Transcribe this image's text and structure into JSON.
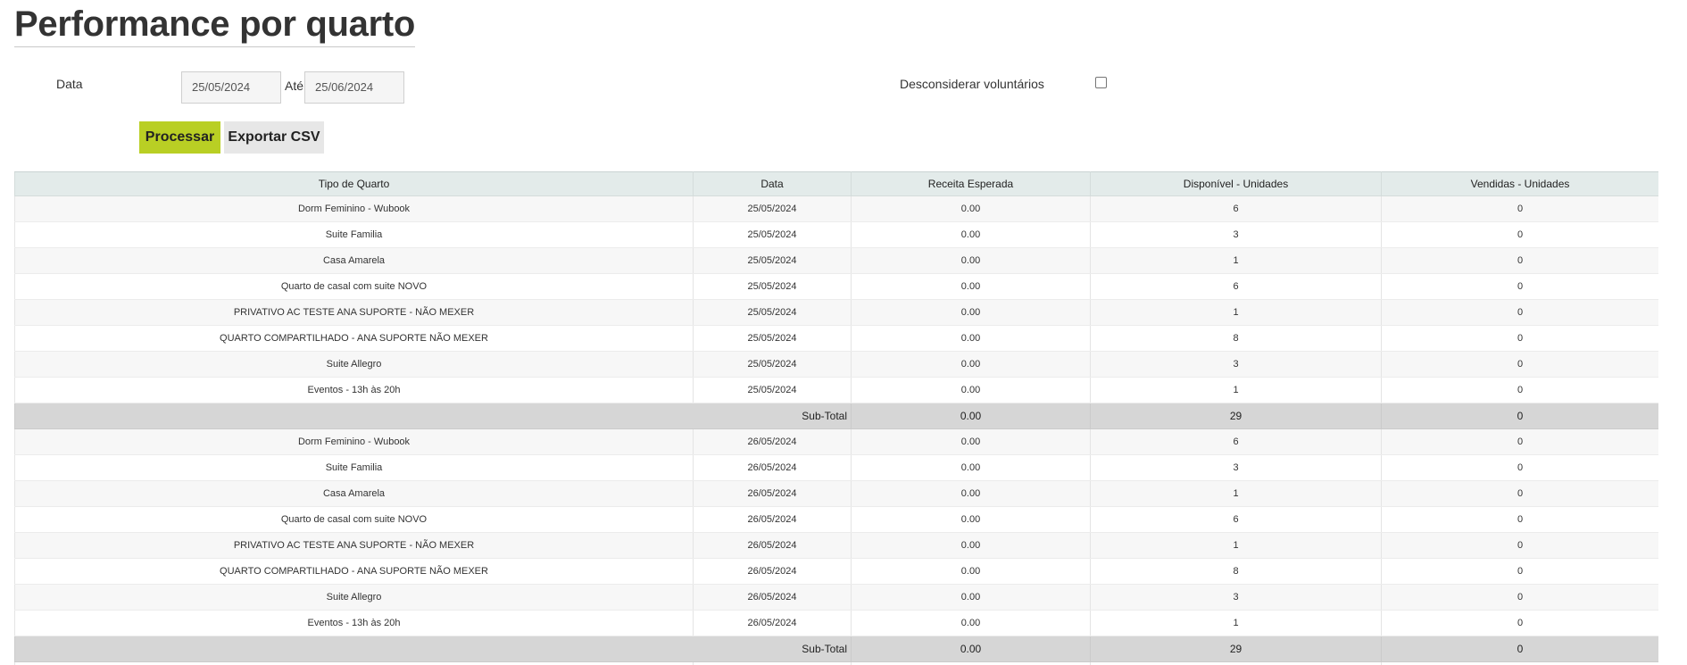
{
  "page": {
    "title": "Performance por quarto"
  },
  "filters": {
    "date_label": "Data",
    "start_date": "25/05/2024",
    "until_label": "Até",
    "end_date": "25/06/2024",
    "exclude_volunteers_label": "Desconsiderar voluntários",
    "exclude_volunteers_checked": false
  },
  "actions": {
    "process_label": "Processar",
    "export_label": "Exportar CSV"
  },
  "colors": {
    "accent": "#b9cf24",
    "header_bg": "#e3ebea",
    "subtotal_bg": "#d6d6d6"
  },
  "table": {
    "headers": [
      "Tipo de Quarto",
      "Data",
      "Receita Esperada",
      "Disponível - Unidades",
      "Vendidas - Unidades"
    ],
    "subtotal_label": "Sub-Total",
    "groups": [
      {
        "rows": [
          [
            "Dorm Feminino - Wubook",
            "25/05/2024",
            "0.00",
            "6",
            "0"
          ],
          [
            "Suite Familia",
            "25/05/2024",
            "0.00",
            "3",
            "0"
          ],
          [
            "Casa Amarela",
            "25/05/2024",
            "0.00",
            "1",
            "0"
          ],
          [
            "Quarto de casal com suite NOVO",
            "25/05/2024",
            "0.00",
            "6",
            "0"
          ],
          [
            "PRIVATIVO AC TESTE ANA SUPORTE - NÃO MEXER",
            "25/05/2024",
            "0.00",
            "1",
            "0"
          ],
          [
            "QUARTO COMPARTILHADO - ANA SUPORTE NÃO MEXER",
            "25/05/2024",
            "0.00",
            "8",
            "0"
          ],
          [
            "Suite Allegro",
            "25/05/2024",
            "0.00",
            "3",
            "0"
          ],
          [
            "Eventos - 13h às 20h",
            "25/05/2024",
            "0.00",
            "1",
            "0"
          ]
        ],
        "subtotal": [
          "0.00",
          "29",
          "0"
        ]
      },
      {
        "rows": [
          [
            "Dorm Feminino - Wubook",
            "26/05/2024",
            "0.00",
            "6",
            "0"
          ],
          [
            "Suite Familia",
            "26/05/2024",
            "0.00",
            "3",
            "0"
          ],
          [
            "Casa Amarela",
            "26/05/2024",
            "0.00",
            "1",
            "0"
          ],
          [
            "Quarto de casal com suite NOVO",
            "26/05/2024",
            "0.00",
            "6",
            "0"
          ],
          [
            "PRIVATIVO AC TESTE ANA SUPORTE - NÃO MEXER",
            "26/05/2024",
            "0.00",
            "1",
            "0"
          ],
          [
            "QUARTO COMPARTILHADO - ANA SUPORTE NÃO MEXER",
            "26/05/2024",
            "0.00",
            "8",
            "0"
          ],
          [
            "Suite Allegro",
            "26/05/2024",
            "0.00",
            "3",
            "0"
          ],
          [
            "Eventos - 13h às 20h",
            "26/05/2024",
            "0.00",
            "1",
            "0"
          ]
        ],
        "subtotal": [
          "0.00",
          "29",
          "0"
        ]
      }
    ]
  }
}
